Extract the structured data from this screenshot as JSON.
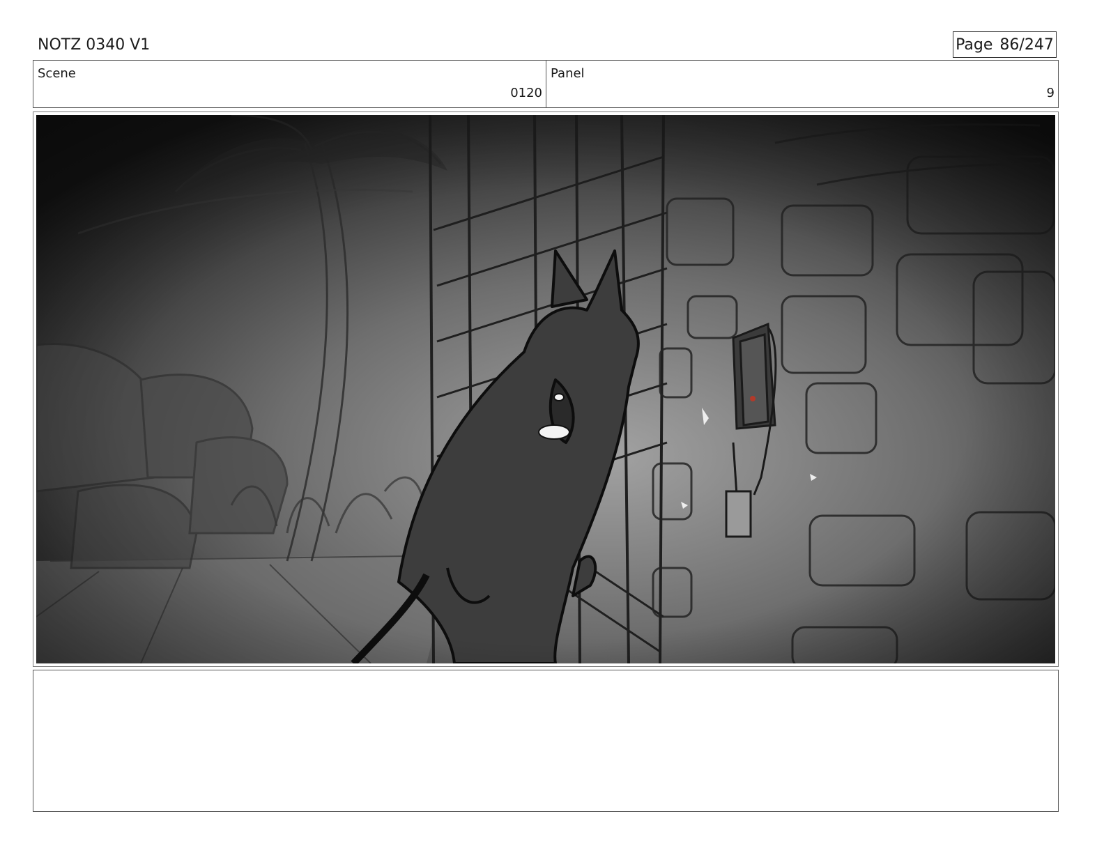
{
  "header": {
    "title": "NOTZ 0340 V1",
    "page_label": "Page",
    "page_number": "86/247"
  },
  "scene": {
    "label": "Scene",
    "value": "0120"
  },
  "panel": {
    "label": "Panel",
    "value": "9"
  },
  "notes": {
    "text": ""
  },
  "colors": {
    "border": "#555555",
    "sketch_dark": "#1c1c1c",
    "character_fill": "#3d3d3d",
    "accent_light": "#b23a2a"
  },
  "icons": [
    "storyboard-frame-image"
  ]
}
